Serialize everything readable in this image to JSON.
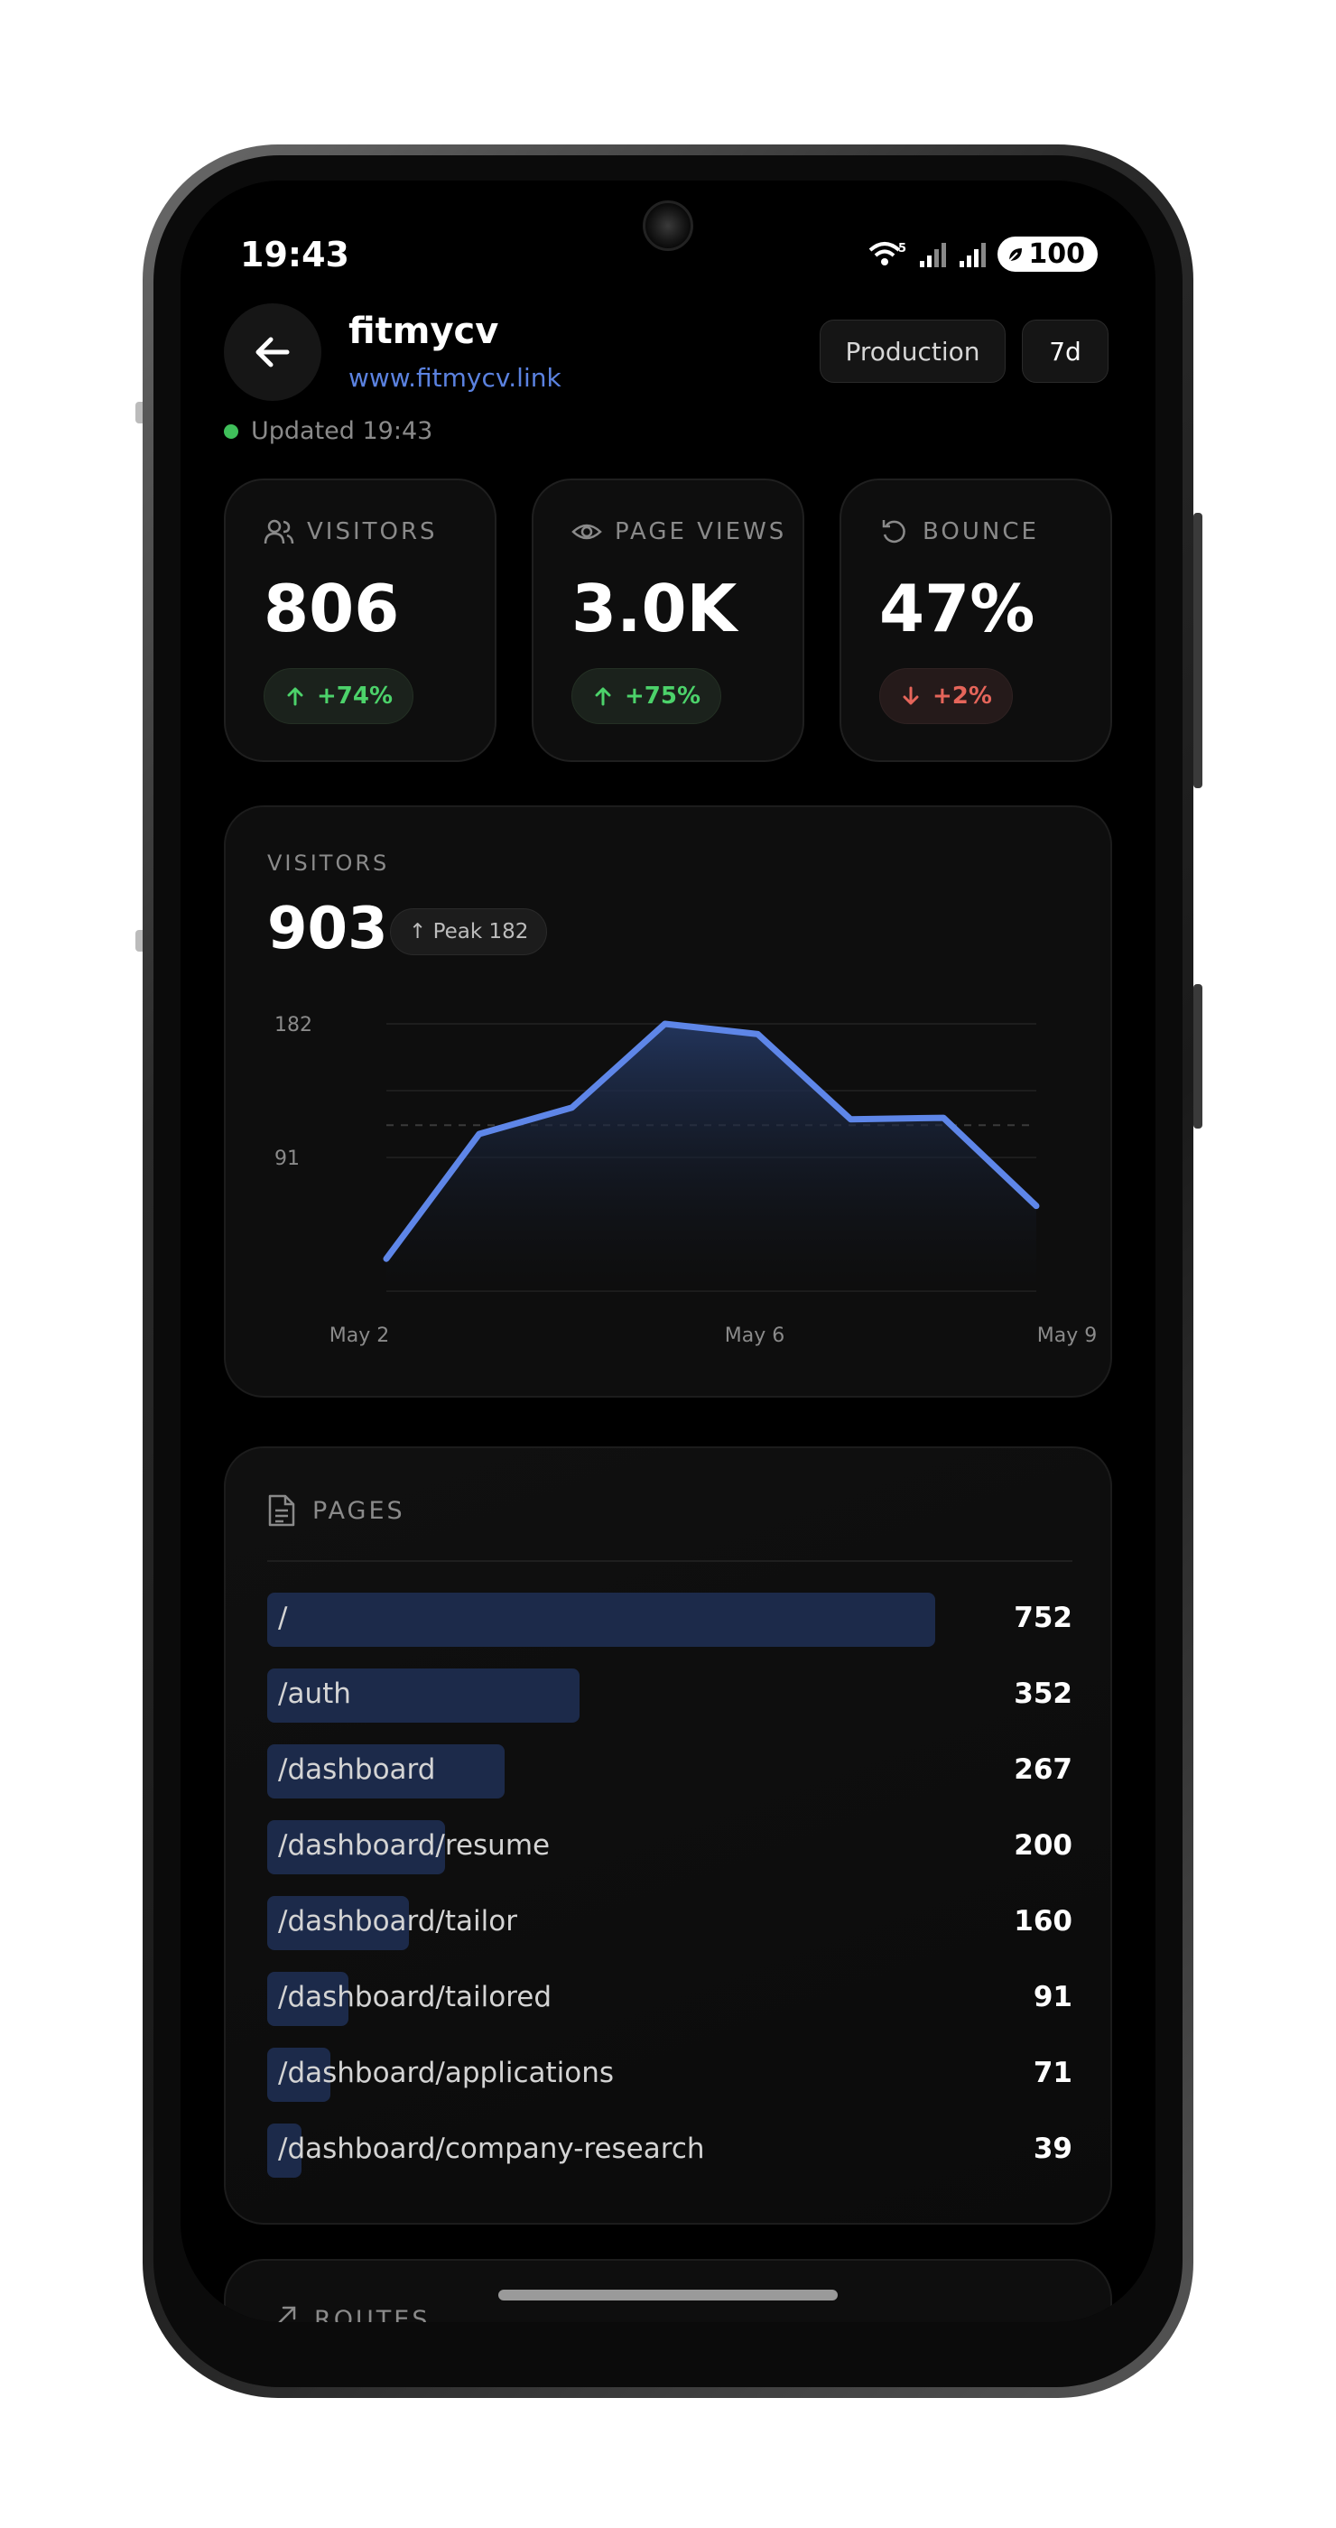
{
  "status": {
    "time": "19:43",
    "battery": "100",
    "wifi_badge": "5"
  },
  "header": {
    "title": "fitmycv",
    "url": "www.fitmycv.link",
    "environment": "Production",
    "range": "7d"
  },
  "updated": {
    "text": "Updated 19:43"
  },
  "stats": [
    {
      "label": "VISITORS",
      "value": "806",
      "delta": "+74%",
      "direction": "up",
      "icon": "users-icon"
    },
    {
      "label": "PAGE VIEWS",
      "value": "3.0K",
      "delta": "+75%",
      "direction": "up",
      "icon": "eye-icon"
    },
    {
      "label": "BOUNCE",
      "value": "47%",
      "delta": "+2%",
      "direction": "down",
      "icon": "refresh-icon"
    }
  ],
  "chart": {
    "label": "VISITORS",
    "total": "903",
    "peak": "↑ Peak 182"
  },
  "chart_data": {
    "type": "area",
    "x": [
      "May 2",
      "May 3",
      "May 4",
      "May 5",
      "May 6",
      "May 7",
      "May 8",
      "May 9"
    ],
    "values": [
      22,
      107,
      125,
      182,
      175,
      117,
      118,
      58
    ],
    "y_ticks": [
      "182",
      "91"
    ],
    "x_ticks": [
      "May 2",
      "May 6",
      "May 9"
    ],
    "ylim": [
      0,
      182
    ],
    "average": 113,
    "colors": {
      "line": "#5e86e8",
      "fill": "#1d2d55"
    }
  },
  "pages": {
    "title": "PAGES",
    "max": 752,
    "rows": [
      {
        "path": "/",
        "count": "752",
        "value": 752
      },
      {
        "path": "/auth",
        "count": "352",
        "value": 352
      },
      {
        "path": "/dashboard",
        "count": "267",
        "value": 267
      },
      {
        "path": "/dashboard/resume",
        "count": "200",
        "value": 200
      },
      {
        "path": "/dashboard/tailor",
        "count": "160",
        "value": 160
      },
      {
        "path": "/dashboard/tailored",
        "count": "91",
        "value": 91
      },
      {
        "path": "/dashboard/applications",
        "count": "71",
        "value": 71
      },
      {
        "path": "/dashboard/company-research",
        "count": "39",
        "value": 39
      }
    ]
  },
  "routes": {
    "title": "ROUTES"
  }
}
